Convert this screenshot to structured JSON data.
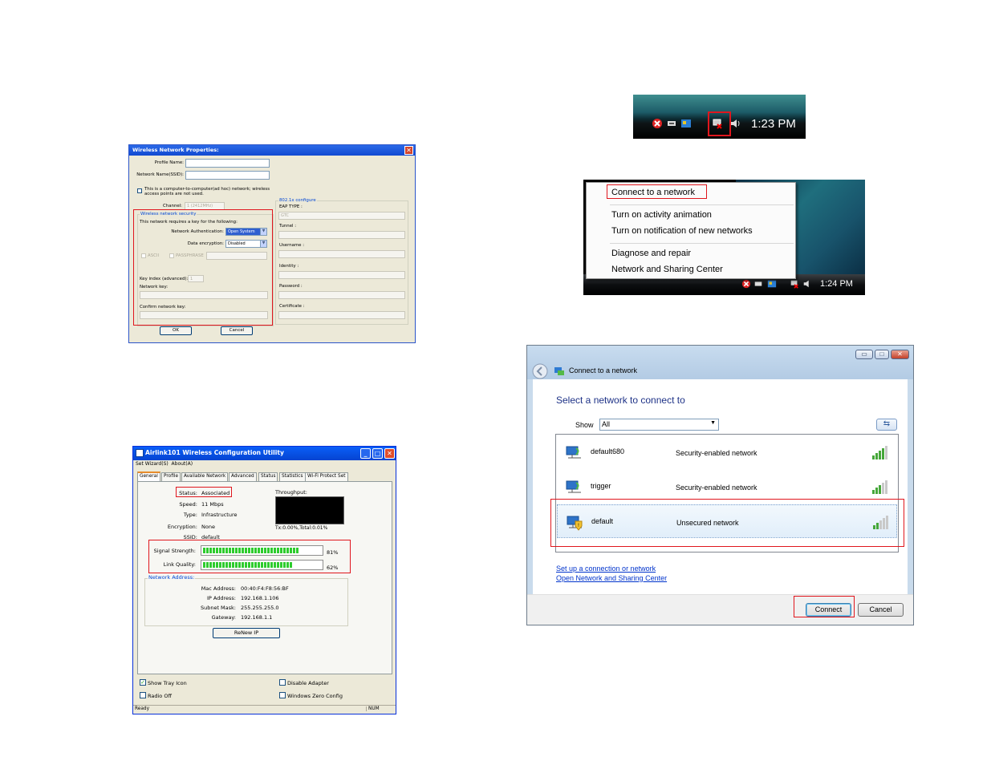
{
  "wnp": {
    "title": "Wireless Network Properties:",
    "close": "✕",
    "profile_name_label": "Profile Name:",
    "ssid_label": "Network Name(SSID):",
    "adhoc_text_line1": "This is a computer-to-computer(ad hoc) network; wireless",
    "adhoc_text_line2": "access points are not used.",
    "channel_label": "Channel:",
    "channel_value": "1 (2412MHz)",
    "security_group": "Wireless network security",
    "security_note": "This network requires a key for the following:",
    "auth_label": "Network Authentication:",
    "auth_value": "Open System",
    "enc_label": "Data encryption:",
    "enc_value": "Disabled",
    "ascii_label": "ASCII",
    "passphrase_label": "PASSPHRASE",
    "key_index_label": "Key index (advanced):",
    "key_index_value": "1",
    "network_key_label": "Network key:",
    "confirm_key_label": "Confirm network key:",
    "ok": "OK",
    "cancel": "Cancel",
    "x8021_group": "802.1x configure",
    "eap_label": "EAP TYPE :",
    "eap_value": "GTC",
    "tunnel_label": "Tunnel :",
    "username_label": "Username :",
    "identity_label": "Identity :",
    "password_label": "Password :",
    "certificate_label": "Certificate :"
  },
  "alk": {
    "title": "Airlink101 Wireless Configuration Utility",
    "menu": [
      "Set Wizard(S)",
      "About(A)"
    ],
    "tabs": [
      "General",
      "Profile",
      "Available Network",
      "Advanced",
      "Status",
      "Statistics",
      "Wi-Fi Protect Set"
    ],
    "status_label": "Status:",
    "status_value": "Associated",
    "speed_label": "Speed:",
    "speed_value": "11 Mbps",
    "type_label": "Type:",
    "type_value": "Infrastructure",
    "encryption_label": "Encryption:",
    "encryption_value": "None",
    "ssid_label": "SSID:",
    "ssid_value": "default",
    "throughput_label": "Throughput:",
    "throughput_value": "Tx:0.00%,Total:0.01%",
    "signal_label": "Signal Strength:",
    "signal_pct": "81%",
    "signal_level": 0.81,
    "link_label": "Link Quality:",
    "link_pct": "62%",
    "link_level": 0.76,
    "net_group": "Network Address:",
    "mac_label": "Mac Address:",
    "mac_value": "00:40:F4:F8:56:BF",
    "ip_label": "IP Address:",
    "ip_value": "192.168.1.106",
    "mask_label": "Subnet Mask:",
    "mask_value": "255.255.255.0",
    "gw_label": "Gateway:",
    "gw_value": "192.168.1.1",
    "renew": "ReNew IP",
    "show_tray": "Show Tray Icon",
    "radio_off": "Radio Off",
    "disable_adapter": "Disable Adapter",
    "wzc": "Windows Zero Config",
    "status_ready": "Ready",
    "status_num": "NUM"
  },
  "tray1": {
    "time": "1:23 PM"
  },
  "ctx": {
    "items": [
      "Connect to a network",
      "Turn on activity animation",
      "Turn on notification of new networks",
      "Diagnose and repair",
      "Network and Sharing Center"
    ],
    "time": "1:24 PM"
  },
  "vcd": {
    "window_title": "Connect to a network",
    "heading": "Select a network to connect to",
    "show_label": "Show",
    "show_value": "All",
    "networks": [
      {
        "name": "default680",
        "type": "Security-enabled network"
      },
      {
        "name": "trigger",
        "type": "Security-enabled network"
      },
      {
        "name": "default",
        "type": "Unsecured network"
      }
    ],
    "link_setup": "Set up a connection or network",
    "link_center": "Open Network and Sharing Center",
    "connect": "Connect",
    "cancel": "Cancel"
  },
  "colors": {
    "highlight_red": "#e0161d",
    "xp_blue": "#0a5ff8",
    "signal_green": "#2ecc2e",
    "vista_link": "#0033cc"
  }
}
